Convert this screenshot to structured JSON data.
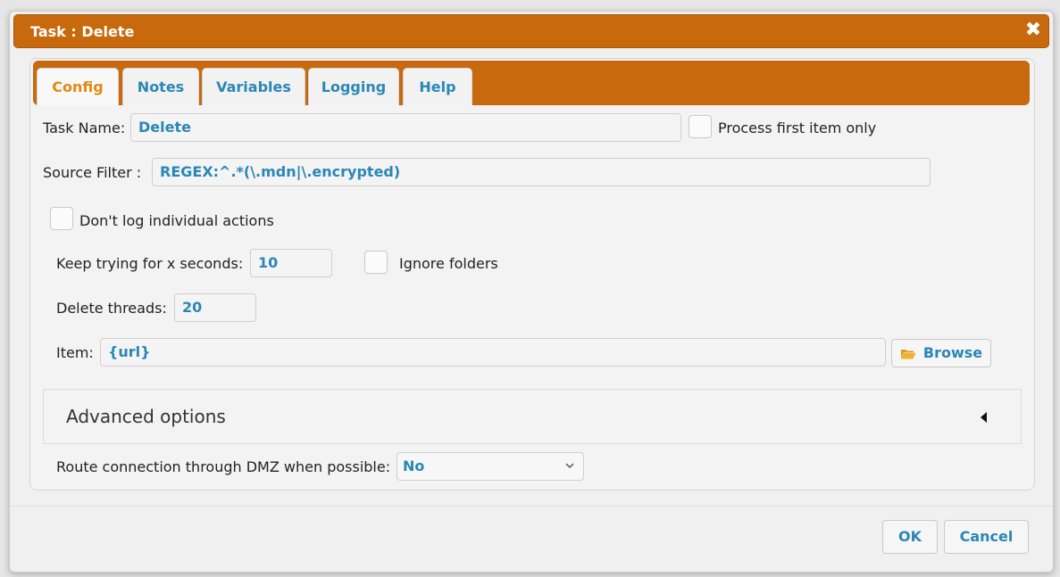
{
  "dialog": {
    "title": "Task : Delete",
    "close_icon": "close-icon"
  },
  "tabs": [
    {
      "label": "Config",
      "active": true
    },
    {
      "label": "Notes",
      "active": false
    },
    {
      "label": "Variables",
      "active": false
    },
    {
      "label": "Logging",
      "active": false
    },
    {
      "label": "Help",
      "active": false
    }
  ],
  "config": {
    "task_name_label": "Task Name:",
    "task_name_value": "Delete",
    "process_first_label": "Process first item only",
    "process_first_checked": false,
    "source_filter_label": "Source Filter :",
    "source_filter_value": "REGEX:^.*(\\.mdn|\\.encrypted)",
    "dont_log_label": "Don't log individual actions",
    "dont_log_checked": false,
    "keep_trying_label": "Keep trying for x seconds:",
    "keep_trying_value": "10",
    "ignore_folders_label": "Ignore folders",
    "ignore_folders_checked": false,
    "delete_threads_label": "Delete threads:",
    "delete_threads_value": "20",
    "item_label": "Item:",
    "item_value": "{url}",
    "browse_label": "Browse",
    "advanced_label": "Advanced options",
    "route_label": "Route connection through DMZ when possible:",
    "route_value": "No"
  },
  "footer": {
    "ok_label": "OK",
    "cancel_label": "Cancel"
  },
  "colors": {
    "accent": "#c8690d",
    "link": "#2a87b4",
    "active_tab": "#e08a13"
  }
}
